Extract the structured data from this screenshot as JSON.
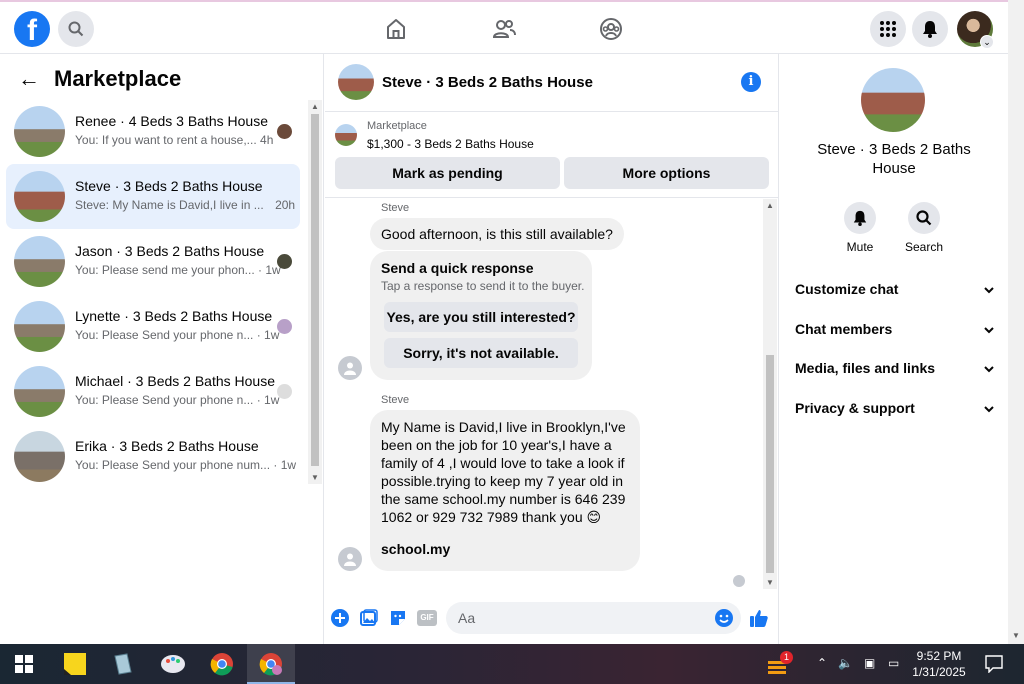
{
  "topbar": {
    "logo": "f"
  },
  "marketplace": {
    "back_icon": "arrow-left-icon",
    "title": "Marketplace",
    "conversations": [
      {
        "title": "Renee · 4 Beds 3 Baths House",
        "preview": "You: If you want to rent a house,...",
        "time": "4h"
      },
      {
        "title": "Steve · 3 Beds 2 Baths House",
        "preview": "Steve: My Name is David,I live in ...",
        "time": "20h"
      },
      {
        "title": "Jason · 3 Beds 2 Baths House",
        "preview": "You: Please send me your phon...",
        "time": "· 1w"
      },
      {
        "title": "Lynette · 3 Beds 2 Baths House",
        "preview": "You: Please Send your phone n...",
        "time": "· 1w"
      },
      {
        "title": "Michael · 3 Beds 2 Baths House",
        "preview": "You: Please Send your phone n...",
        "time": "· 1w"
      },
      {
        "title": "Erika · 3 Beds 2 Baths House",
        "preview": "You: Please Send your phone num...",
        "time": "· 1w"
      }
    ]
  },
  "chat": {
    "header_name": "Steve · 3 Beds 2 Baths House",
    "info_icon": "i",
    "listing_source": "Marketplace",
    "listing_price": "$1,300 - 3 Beds 2 Baths House",
    "mark_pending": "Mark as pending",
    "more_options": "More options",
    "sender1": "Steve",
    "msg1": "Good afternoon, is this still available?",
    "quick_title": "Send a quick response",
    "quick_sub": "Tap a response to send it to the buyer.",
    "quick_btn1": "Yes, are you still interested?",
    "quick_btn2": "Sorry, it's not available.",
    "sender2": "Steve",
    "msg2": "My Name is David,I live in Brooklyn,I've been on the job for 10 year's,I have a family of 4 ,I would love to  take a look if possible.trying to keep my 7 year old in the same school.my  number is 646 239 1062 or 929 732 7989 thank you 😊",
    "msg2_link": "school.my",
    "input_placeholder": "Aa",
    "gif_label": "GIF"
  },
  "details": {
    "name": "Steve · 3 Beds 2 Baths House",
    "mute": "Mute",
    "search": "Search",
    "sections": [
      "Customize chat",
      "Chat members",
      "Media, files and links",
      "Privacy & support"
    ]
  },
  "taskbar": {
    "time": "9:52 PM",
    "date": "1/31/2025",
    "notification_count": "1"
  },
  "colors": {
    "accent": "#1877f2",
    "active_conv": "#e7f0fd"
  }
}
